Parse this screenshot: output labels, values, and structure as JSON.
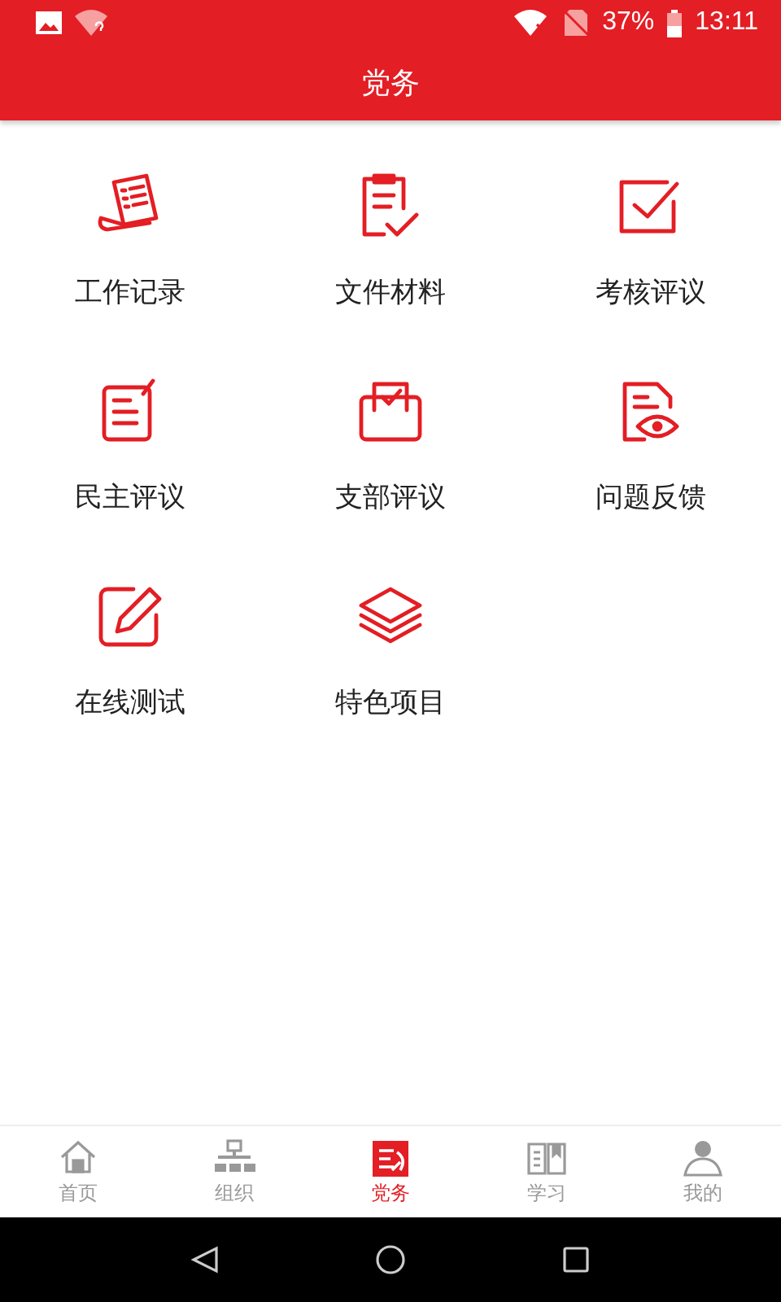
{
  "status_bar": {
    "battery": "37%",
    "time": "13:11"
  },
  "header": {
    "title": "党务"
  },
  "menu": [
    {
      "label": "工作记录"
    },
    {
      "label": "文件材料"
    },
    {
      "label": "考核评议"
    },
    {
      "label": "民主评议"
    },
    {
      "label": "支部评议"
    },
    {
      "label": "问题反馈"
    },
    {
      "label": "在线测试"
    },
    {
      "label": "特色项目"
    }
  ],
  "tabs": [
    {
      "label": "首页",
      "selected": false
    },
    {
      "label": "组织",
      "selected": false
    },
    {
      "label": "党务",
      "selected": true
    },
    {
      "label": "学习",
      "selected": false
    },
    {
      "label": "我的",
      "selected": false
    }
  ]
}
